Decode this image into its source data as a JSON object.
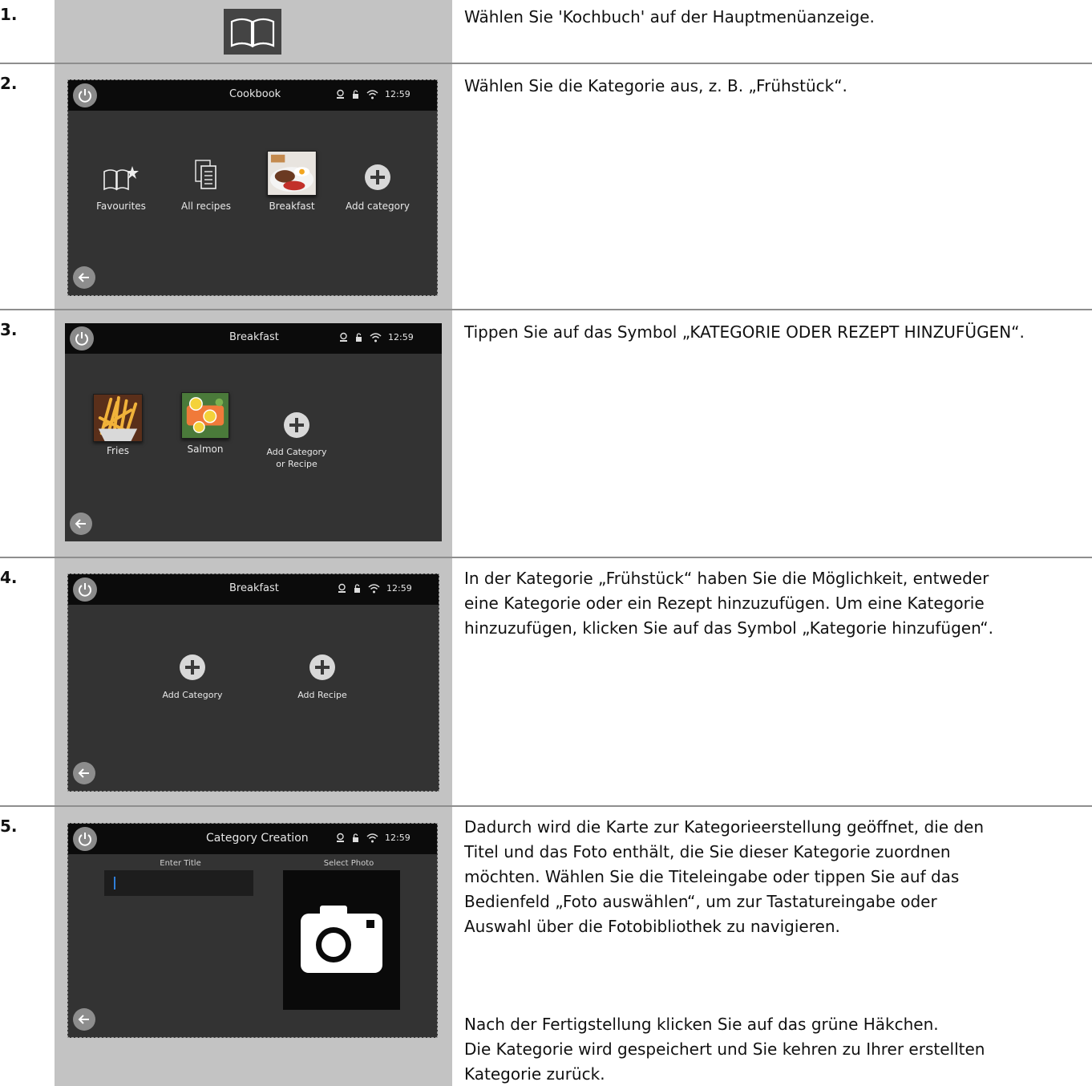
{
  "steps": [
    {
      "number": "1.",
      "text": "Wählen Sie 'Kochbuch' auf der Hauptmenüanzeige.",
      "icon": "book-icon"
    },
    {
      "number": "2.",
      "text": "Wählen Sie die Kategorie aus, z. B. „Frühstück“.",
      "screen": {
        "title": "Cookbook",
        "time": "12:59",
        "items": [
          "Favourites",
          "All recipes",
          "Breakfast",
          "Add category"
        ]
      }
    },
    {
      "number": "3.",
      "text": "Tippen Sie auf das Symbol „KATEGORIE ODER REZEPT HINZUFÜGEN“.",
      "screen": {
        "title": "Breakfast",
        "time": "12:59",
        "items": [
          "Fries",
          "Salmon",
          "Add Category",
          "or Recipe"
        ]
      }
    },
    {
      "number": "4.",
      "lines": [
        "In der Kategorie „Frühstück“ haben Sie die Möglichkeit, entweder",
        "eine Kategorie oder ein Rezept hinzuzufügen. Um eine Kategorie",
        "hinzuzufügen, klicken Sie auf das Symbol „Kategorie hinzufügen“."
      ],
      "screen": {
        "title": "Breakfast",
        "time": "12:59",
        "items": [
          "Add Category",
          "Add Recipe"
        ]
      }
    },
    {
      "number": "5.",
      "lines": [
        "Dadurch wird die Karte zur Kategorieerstellung geöffnet, die den",
        "Titel und das Foto enthält, die Sie dieser Kategorie zuordnen",
        "möchten. Wählen Sie die Titeleingabe oder tippen Sie auf das",
        "Bedienfeld „Foto auswählen“, um zur Tastatureingabe oder",
        "Auswahl über die Fotobibliothek zu navigieren."
      ],
      "lines2": [
        "Nach der Fertigstellung klicken Sie auf das grüne Häkchen.",
        "Die Kategorie wird gespeichert und Sie kehren zu Ihrer erstellten",
        "Kategorie zurück."
      ],
      "screen": {
        "title": "Category Creation",
        "time": "12:59",
        "enter_title_label": "Enter Title",
        "select_photo_label": "Select Photo"
      }
    }
  ],
  "colors": {
    "image_column_bg": "#c3c3c3",
    "screen_bg": "#333333",
    "status_bar_bg": "#0b0b0b",
    "separator": "#8e8e8e"
  }
}
